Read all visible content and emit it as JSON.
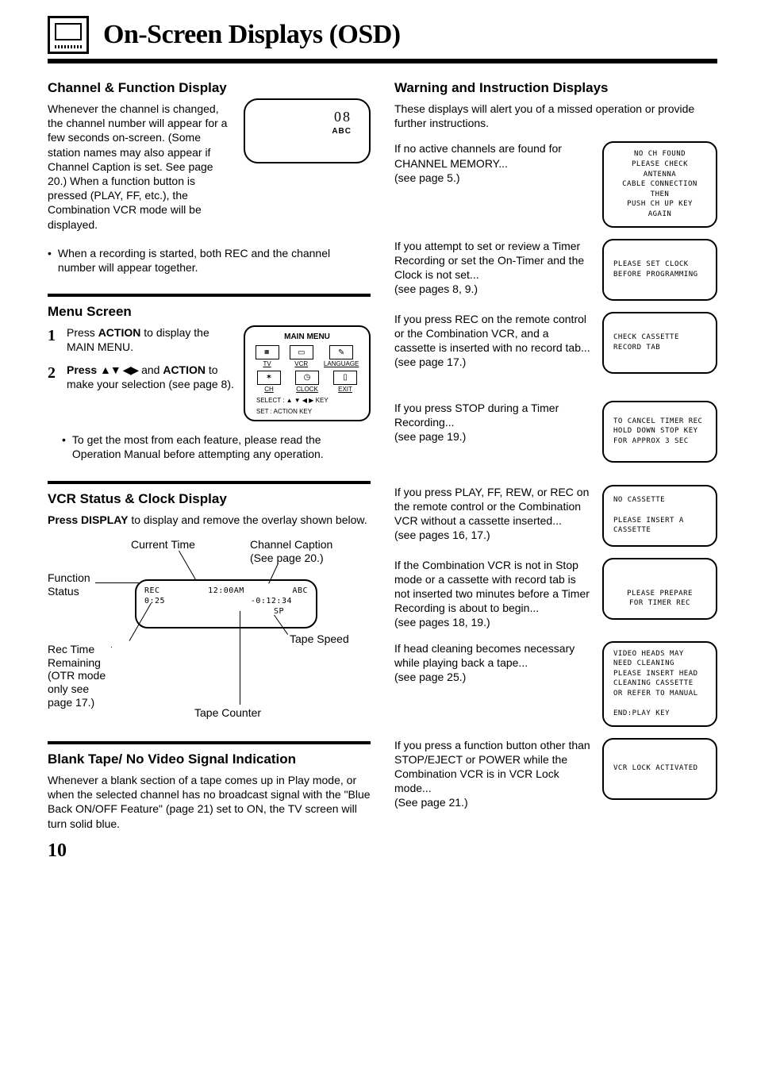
{
  "page_title": "On-Screen Displays (OSD)",
  "page_number": "10",
  "left": {
    "channel": {
      "title": "Channel & Function Display",
      "body1": "Whenever the channel is changed, the channel number will appear for a few seconds on-screen. (Some station names may also appear if Channel Caption is set. See page 20.) When a function button is pressed (PLAY, FF, etc.), the Combination VCR mode will be displayed.",
      "bullet": "When a recording is started, both REC and the channel number will appear together.",
      "box_num": "08",
      "box_sub": "ABC"
    },
    "menu": {
      "title": "Menu Screen",
      "step1_lead": "Press ",
      "step1_bold": "ACTION",
      "step1_after": " to display the MAIN MENU.",
      "step2_lead": "Press ",
      "step2_bold2": "ACTION",
      "step2_mid": " and ",
      "step2_after": " to make your selection (see page 8).",
      "bullet": "To get the most from each feature, please read the Operation Manual before attempting any operation.",
      "box_title": "MAIN MENU",
      "menu_items": {
        "tv": "TV",
        "vcr": "VCR",
        "lang": "LANGUAGE",
        "ch": "CH",
        "clock": "CLOCK",
        "exit": "EXIT"
      },
      "footer1": "SELECT : ▲ ▼ ◀ ▶  KEY",
      "footer2": "SET     : ACTION KEY"
    },
    "vcr": {
      "title": "VCR Status & Clock Display",
      "lead_bold": "Press DISPLAY",
      "lead_after": " to display and remove the overlay shown below.",
      "labels": {
        "current_time": "Current Time",
        "channel_caption": "Channel Caption\n(See page 20.)",
        "function_status": "Function\nStatus",
        "tape_speed": "Tape Speed",
        "rec_time": "Rec Time\nRemaining\n(OTR mode\nonly see\npage 17.)",
        "tape_counter": "Tape Counter"
      },
      "box": {
        "line1a": "REC",
        "line1b": "12:00AM",
        "line1c": "ABC",
        "line2a": "0:25",
        "line2b": "-0:12:34",
        "line3": "SP"
      }
    },
    "blank": {
      "title": "Blank Tape/ No Video Signal Indication",
      "body": "Whenever a blank section of a tape comes up in Play mode, or when the selected channel has no broadcast signal with the \"Blue Back ON/OFF Feature\" (page 21) set to ON, the TV screen will turn solid blue."
    }
  },
  "right": {
    "title": "Warning and Instruction Displays",
    "intro": "These displays will alert you of a missed operation or provide further instructions.",
    "items": [
      {
        "text": "If no active channels are found for CHANNEL MEMORY...\n(see page 5.)",
        "box": "NO CH FOUND\nPLEASE CHECK ANTENNA\nCABLE CONNECTION THEN\nPUSH CH UP KEY AGAIN"
      },
      {
        "text": "If you attempt to set or review a Timer Recording or set the On-Timer and the Clock is not set...\n(see pages 8, 9.)",
        "box": "PLEASE SET CLOCK\nBEFORE PROGRAMMING"
      },
      {
        "text": "If you press REC on the remote control or the Combination VCR, and a cassette is inserted with no record tab...\n(see page 17.)",
        "box": "CHECK CASSETTE\nRECORD TAB"
      },
      {
        "text": "If you press STOP during a Timer Recording...\n(see page 19.)",
        "box": "TO CANCEL TIMER REC\nHOLD DOWN STOP KEY\nFOR APPROX 3 SEC"
      },
      {
        "text": "If you press PLAY, FF, REW, or REC on the remote control or the Combination VCR without a cassette inserted...\n(see pages 16, 17.)",
        "box": "NO CASSETTE\n\nPLEASE INSERT A CASSETTE"
      },
      {
        "text": "If the Combination VCR is not in Stop mode or a cassette with record tab is not inserted two minutes before a Timer Recording is about to begin...\n(see pages 18, 19.)",
        "box": "\n\nPLEASE PREPARE\nFOR TIMER REC"
      },
      {
        "text": "If head cleaning becomes necessary while playing back a tape...\n(see page 25.)",
        "box": "VIDEO HEADS MAY\nNEED CLEANING\nPLEASE INSERT HEAD\nCLEANING CASSETTE\nOR REFER TO MANUAL\n\nEND:PLAY KEY"
      },
      {
        "text": "If you press a function button other than STOP/EJECT or POWER while the Combination VCR is in VCR Lock mode...\n(See page 21.)",
        "box": "VCR LOCK ACTIVATED"
      }
    ]
  }
}
